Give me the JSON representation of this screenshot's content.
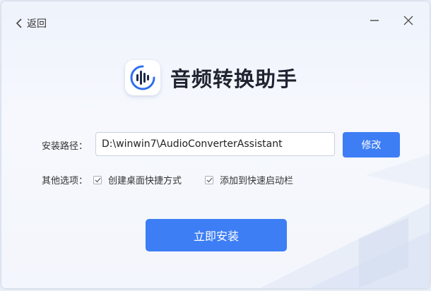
{
  "header": {
    "back_label": "返回"
  },
  "app": {
    "title": "音频转换助手"
  },
  "install_path": {
    "label": "安装路径：",
    "value": "D:\\winwin7\\AudioConverterAssistant",
    "modify_label": "修改"
  },
  "options": {
    "label": "其他选项：",
    "items": [
      {
        "label": "创建桌面快捷方式",
        "checked": true
      },
      {
        "label": "添加到快速启动栏",
        "checked": true
      }
    ]
  },
  "install_button": {
    "label": "立即安装"
  },
  "colors": {
    "accent": "#3d7ef5",
    "background": "#eef3fc"
  }
}
